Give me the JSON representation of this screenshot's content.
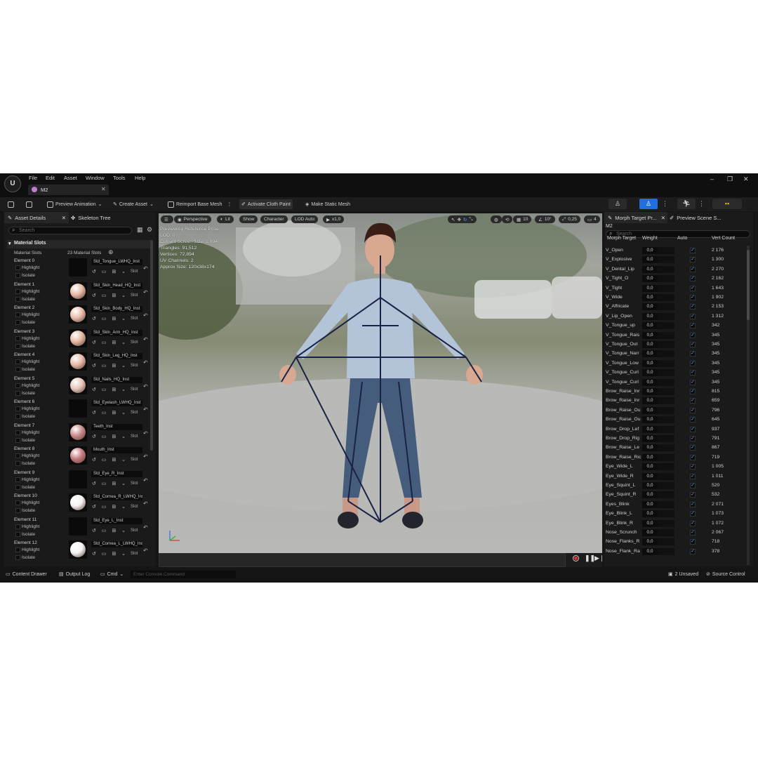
{
  "window": {
    "document_tab": "M2",
    "menu": [
      "File",
      "Edit",
      "Asset",
      "Window",
      "Tools",
      "Help"
    ]
  },
  "toolbar": {
    "preview_animation": "Preview Animation",
    "create_asset": "Create Asset",
    "reimport_base_mesh": "Reimport Base Mesh",
    "activate_cloth_paint": "Activate Cloth Paint",
    "make_static_mesh": "Make Static Mesh"
  },
  "left_panel": {
    "tab_asset_details": "Asset Details",
    "tab_skeleton_tree": "Skeleton Tree",
    "search_placeholder": "Search",
    "section_title": "Material Slots",
    "slots_label": "Material Slots",
    "slots_count": "23 Material Slots",
    "highlight_label": "Highlight",
    "isolate_label": "Isolate",
    "slot_label": "Slot",
    "elements": [
      {
        "label": "Element 0",
        "material": "Std_Tongue_LWHQ_Inst",
        "color": "#000000"
      },
      {
        "label": "Element 1",
        "material": "Std_Skin_Head_HQ_Inst",
        "color": "#e6b9a6"
      },
      {
        "label": "Element 2",
        "material": "Std_Skin_Body_HQ_Inst",
        "color": "#e8bca8"
      },
      {
        "label": "Element 3",
        "material": "Std_Skin_Arm_HQ_Inst",
        "color": "#e6b8a2"
      },
      {
        "label": "Element 4",
        "material": "Std_Skin_Leg_HQ_Inst",
        "color": "#e7baa6"
      },
      {
        "label": "Element 5",
        "material": "Std_Nails_HQ_Inst",
        "color": "#e7c6bc"
      },
      {
        "label": "Element 6",
        "material": "Std_Eyelash_LWHQ_Inst",
        "color": "#000000"
      },
      {
        "label": "Element 7",
        "material": "Teeth_Inst",
        "color": "#c98a8c"
      },
      {
        "label": "Element 8",
        "material": "Mouth_Inst",
        "color": "#c77b80"
      },
      {
        "label": "Element 9",
        "material": "Std_Eye_R_Inst",
        "color": "#000000"
      },
      {
        "label": "Element 10",
        "material": "Std_Cornea_R_LWHQ_Inst",
        "color": "#f4f4f4"
      },
      {
        "label": "Element 11",
        "material": "Std_Eye_L_Inst",
        "color": "#000000"
      },
      {
        "label": "Element 12",
        "material": "Std_Cornea_L_LWHQ_Inst",
        "color": "#f4f4f4"
      }
    ]
  },
  "viewport": {
    "perspective": "Perspective",
    "lit": "Lit",
    "show": "Show",
    "character": "Character",
    "lod": "LOD Auto",
    "speed": "x1,0",
    "grid_snap": "10",
    "angle_snap": "10°",
    "scale_snap": "0,25",
    "camera_speed": "4",
    "stats": [
      "Previewing Reference Pose",
      "LOD: 0",
      "Current Screen Size: 1,094",
      "Triangles: 91,512",
      "Vertices: 72,894",
      "UV Channels: 2",
      "Approx Size: 120x38x174"
    ]
  },
  "right_panel": {
    "tab_morph": "Morph Target Pr...",
    "tab_preview_scene": "Preview Scene S...",
    "asset_name": "M2",
    "search_placeholder": "Search",
    "col_morph": "Morph Target",
    "col_weight": "Weight",
    "col_auto": "Auto",
    "col_vert": "Vert Count",
    "rows": [
      {
        "name": "V_Open",
        "weight": "0,0",
        "count": "2 176"
      },
      {
        "name": "V_Explosive",
        "weight": "0,0",
        "count": "1 300"
      },
      {
        "name": "V_Dental_Lip",
        "weight": "0,0",
        "count": "2 270"
      },
      {
        "name": "V_Tight_O",
        "weight": "0,0",
        "count": "2 162"
      },
      {
        "name": "V_Tight",
        "weight": "0,0",
        "count": "1 643"
      },
      {
        "name": "V_Wide",
        "weight": "0,0",
        "count": "1 902"
      },
      {
        "name": "V_Affricate",
        "weight": "0,0",
        "count": "2 153"
      },
      {
        "name": "V_Lip_Open",
        "weight": "0,0",
        "count": "1 312"
      },
      {
        "name": "V_Tongue_up",
        "weight": "0,0",
        "count": "342"
      },
      {
        "name": "V_Tongue_Rais",
        "weight": "0,0",
        "count": "345"
      },
      {
        "name": "V_Tongue_Out",
        "weight": "0,0",
        "count": "345"
      },
      {
        "name": "V_Tongue_Narr",
        "weight": "0,0",
        "count": "345"
      },
      {
        "name": "V_Tongue_Low",
        "weight": "0,0",
        "count": "345"
      },
      {
        "name": "V_Tongue_Curl",
        "weight": "0,0",
        "count": "345"
      },
      {
        "name": "V_Tongue_Curl",
        "weight": "0,0",
        "count": "345"
      },
      {
        "name": "Brow_Raise_Inr",
        "weight": "0,0",
        "count": "815"
      },
      {
        "name": "Brow_Raise_Inr",
        "weight": "0,0",
        "count": "659"
      },
      {
        "name": "Brow_Raise_Ou",
        "weight": "0,0",
        "count": "796"
      },
      {
        "name": "Brow_Raise_Ou",
        "weight": "0,0",
        "count": "645"
      },
      {
        "name": "Brow_Drop_Lef",
        "weight": "0,0",
        "count": "937"
      },
      {
        "name": "Brow_Drop_Rig",
        "weight": "0,0",
        "count": "791"
      },
      {
        "name": "Brow_Raise_Le",
        "weight": "0,0",
        "count": "867"
      },
      {
        "name": "Brow_Raise_Ric",
        "weight": "0,0",
        "count": "719"
      },
      {
        "name": "Eye_Wide_L",
        "weight": "0,0",
        "count": "1 005"
      },
      {
        "name": "Eye_Wide_R",
        "weight": "0,0",
        "count": "1 011"
      },
      {
        "name": "Eye_Squint_L",
        "weight": "0,0",
        "count": "520"
      },
      {
        "name": "Eye_Squint_R",
        "weight": "0,0",
        "count": "532"
      },
      {
        "name": "Eyes_Blink",
        "weight": "0,0",
        "count": "2 071"
      },
      {
        "name": "Eye_Blink_L",
        "weight": "0,0",
        "count": "1 073"
      },
      {
        "name": "Eye_Blink_R",
        "weight": "0,0",
        "count": "1 072"
      },
      {
        "name": "Nose_Scrunch",
        "weight": "0,0",
        "count": "2 067"
      },
      {
        "name": "Nose_Flanks_R",
        "weight": "0,0",
        "count": "718"
      },
      {
        "name": "Nose_Flank_Ra",
        "weight": "0,0",
        "count": "378"
      }
    ]
  },
  "statusbar": {
    "content_drawer": "Content Drawer",
    "output_log": "Output Log",
    "cmd": "Cmd",
    "console_placeholder": "Enter Console Command",
    "unsaved": "2 Unsaved",
    "source_control": "Source Control"
  },
  "colors": {
    "accent_blue": "#1f6fe0",
    "panel": "#1a1a1a",
    "background": "#151515"
  }
}
